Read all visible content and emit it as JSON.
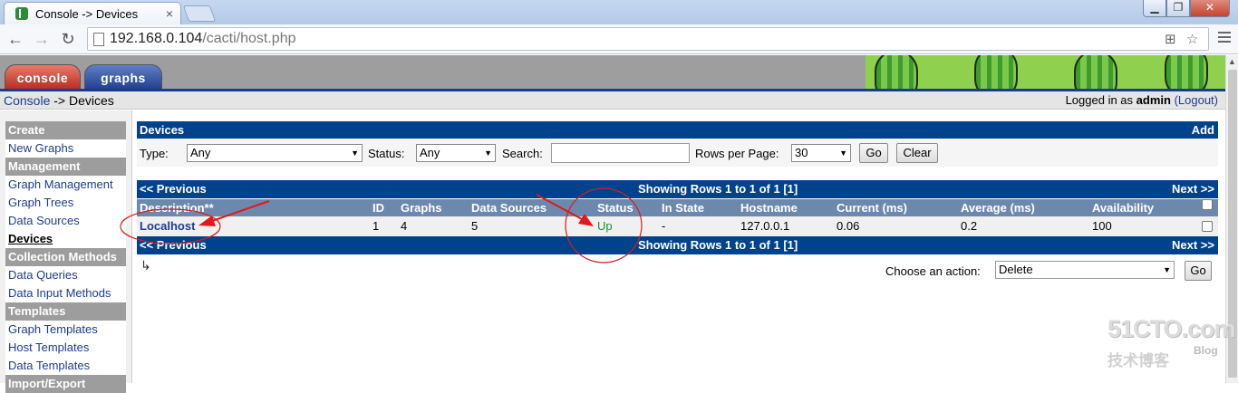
{
  "browser": {
    "tab_title": "Console -> Devices",
    "tab_close": "×",
    "url_host": "192.168.0.104",
    "url_path": "/cacti/host.php",
    "window_controls": [
      "▁",
      "❐",
      "✕"
    ]
  },
  "cacti": {
    "tabs": [
      "console",
      "graphs"
    ],
    "breadcrumb": {
      "parent": "Console",
      "separator": "->",
      "current": "Devices"
    },
    "login": {
      "prefix": "Logged in as",
      "user": "admin",
      "logout": "(Logout)"
    }
  },
  "menu": [
    {
      "label": "Create",
      "type": "header"
    },
    {
      "label": "New Graphs",
      "type": "item"
    },
    {
      "label": "Management",
      "type": "header"
    },
    {
      "label": "Graph Management",
      "type": "item"
    },
    {
      "label": "Graph Trees",
      "type": "item"
    },
    {
      "label": "Data Sources",
      "type": "item"
    },
    {
      "label": "Devices",
      "type": "active"
    },
    {
      "label": "Collection Methods",
      "type": "header"
    },
    {
      "label": "Data Queries",
      "type": "item"
    },
    {
      "label": "Data Input Methods",
      "type": "item"
    },
    {
      "label": "Templates",
      "type": "header"
    },
    {
      "label": "Graph Templates",
      "type": "item"
    },
    {
      "label": "Host Templates",
      "type": "item"
    },
    {
      "label": "Data Templates",
      "type": "item"
    },
    {
      "label": "Import/Export",
      "type": "header"
    }
  ],
  "devices": {
    "title": "Devices",
    "add": "Add",
    "filter": {
      "type_label": "Type:",
      "type_value": "Any",
      "status_label": "Status:",
      "status_value": "Any",
      "search_label": "Search:",
      "search_value": "",
      "rows_label": "Rows per Page:",
      "rows_value": "30",
      "go": "Go",
      "clear": "Clear"
    },
    "pager": {
      "prev": "<< Previous",
      "showing": "Showing Rows 1 to 1 of 1 [1]",
      "next": "Next >>"
    },
    "columns": [
      "Description**",
      "ID",
      "Graphs",
      "Data Sources",
      "Status",
      "In State",
      "Hostname",
      "Current (ms)",
      "Average (ms)",
      "Availability"
    ],
    "rows": [
      {
        "description": "Localhost",
        "id": "1",
        "graphs": "4",
        "data_sources": "5",
        "status": "Up",
        "in_state": "-",
        "hostname": "127.0.0.1",
        "current": "0.06",
        "average": "0.2",
        "availability": "100"
      }
    ],
    "action_label": "Choose an action:",
    "action_value": "Delete",
    "action_go": "Go",
    "corner_glyph": "↳"
  },
  "watermark": {
    "main": "51CTO.com",
    "sub": "技术博客",
    "blog": "Blog"
  }
}
